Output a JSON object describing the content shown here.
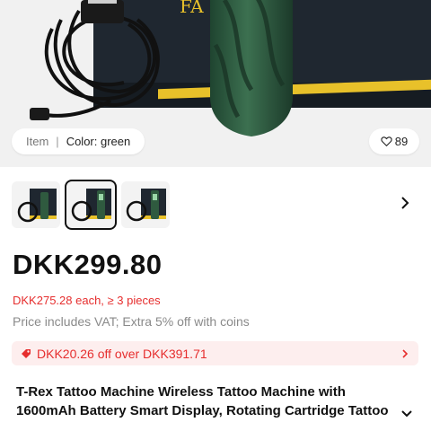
{
  "hero": {
    "variant_label": "Item",
    "variant_separator": "|",
    "variant_value": "Color: green",
    "wishlist_count": "89",
    "box_mark": "FA"
  },
  "thumbnails": {
    "count": 3,
    "selected_index": 1
  },
  "price": {
    "main": "DKK299.80",
    "bulk": "DKK275.28 each, ≥ 3 pieces",
    "vat_note": "Price includes VAT; Extra 5% off with coins"
  },
  "coupon": {
    "text": "DKK20.26 off over DKK391.71"
  },
  "product": {
    "title_line1": "T-Rex Tattoo Machine Wireless Tattoo Machine with",
    "title_line2": "1600mAh Battery Smart Display, Rotating Cartridge Tattoo"
  },
  "colors": {
    "accent_red": "#e62e2e",
    "coupon_bg": "#fdeeee",
    "machine_green": "#2f5a3f"
  },
  "icons": {
    "wishlist": "heart-icon",
    "next": "chevron-right-icon",
    "coupon": "tag-icon",
    "expand": "chevron-down-icon"
  }
}
